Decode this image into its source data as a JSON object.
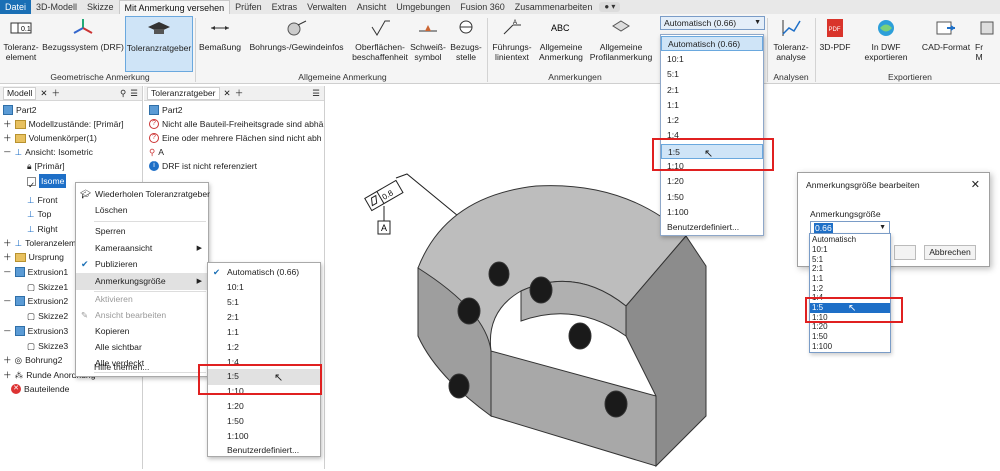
{
  "tabs": [
    "Datei",
    "3D-Modell",
    "Skizze",
    "Mit Anmerkung versehen",
    "Prüfen",
    "Extras",
    "Verwalten",
    "Ansicht",
    "Umgebungen",
    "Fusion 360",
    "Zusammenarbeiten"
  ],
  "ribbon": {
    "geo": {
      "tol_element": "Toleranz-\nelement",
      "bezugssystem": "Bezugssystem (DRF)",
      "toleranzratgeber": "Toleranzratgeber",
      "group": "Geometrische Anmerkung"
    },
    "allg": {
      "bemassung": "Bemaßung",
      "bohrungs": "Bohrungs-/Gewindeinfos",
      "oberflaechen": "Oberflächen-\nbeschaffenheit",
      "schweiss": "Schweiß-\nsymbol",
      "bezugs": "Bezugs-\nstelle",
      "group": "Allgemeine Anmerkung"
    },
    "anm": {
      "fuehrung": "Führungs-\nlinientext",
      "allg_anm": "Allgemeine\nAnmerkung",
      "allg_profil": "Allgemeine\nProfilanmerkung",
      "group": "Anmerkungen"
    },
    "scale_value": "Automatisch (0.66)",
    "analysen": {
      "toleranzanalyse": "Toleranz-\nanalyse",
      "group": "Analysen"
    },
    "export": {
      "pdf3d": "3D-PDF",
      "dwf": "In DWF exportieren",
      "cad": "CAD-Format",
      "fr": "Fr\nM",
      "group": "Exportieren"
    }
  },
  "left_panel": {
    "tab": "Modell",
    "items": [
      "Part2",
      "Modellzustände: [Primär]",
      "Volumenkörper(1)",
      "Ansicht: Isometric",
      "[Primär]",
      "Isome",
      "Front",
      "Top",
      "Right",
      "Toleranzeleme",
      "Ursprung",
      "Extrusion1",
      "Skizze1",
      "Extrusion2",
      "Skizze2",
      "Extrusion3",
      "Skizze3",
      "Bohrung2",
      "Runde Anordnung",
      "Bauteilende"
    ]
  },
  "mid_panel": {
    "tab": "Toleranzratgeber",
    "items": [
      "Part2",
      "Nicht alle Bauteil-Freiheitsgrade sind abhä",
      "Eine oder mehrere Flächen sind nicht abh",
      "A",
      "DRF ist nicht referenziert"
    ]
  },
  "context_menu": [
    "Wiederholen Toleranzratgeber",
    "Löschen",
    "Sperren",
    "Kameraansicht",
    "Publizieren",
    "Anmerkungsgröße",
    "Aktivieren",
    "Ansicht bearbeiten",
    "Kopieren",
    "Alle sichtbar",
    "Alle verdeckt",
    "Hilfe themen..."
  ],
  "scale_options": [
    "Automatisch (0.66)",
    "10:1",
    "5:1",
    "2:1",
    "1:1",
    "1:2",
    "1:4",
    "1:5",
    "1:10",
    "1:20",
    "1:50",
    "1:100",
    "Benutzerdefiniert..."
  ],
  "dialog": {
    "title": "Anmerkungsgröße bearbeiten",
    "label": "Anmerkungsgröße",
    "value": "0.66",
    "cancel": "Abbrechen",
    "close": "✕",
    "options": [
      "Automatisch",
      "10:1",
      "5:1",
      "2:1",
      "1:1",
      "1:2",
      "1:4",
      "1:5",
      "1:10",
      "1:20",
      "1:50",
      "1:100"
    ]
  },
  "canvas": {
    "fcf_value": "0.8",
    "datum": "A"
  }
}
